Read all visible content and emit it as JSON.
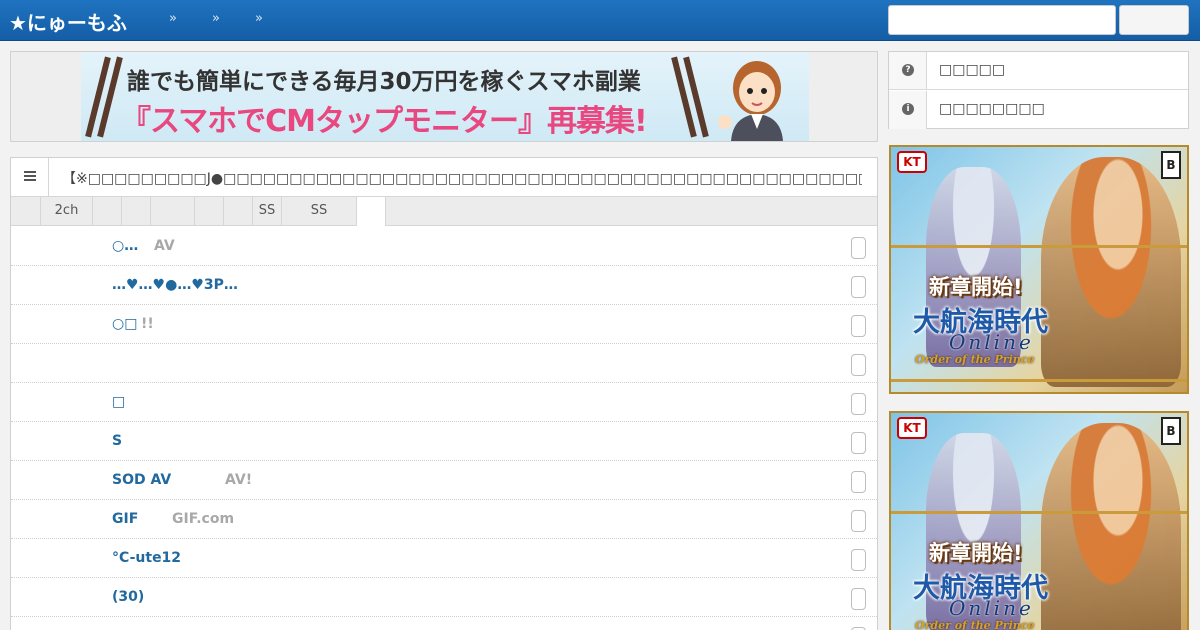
{
  "header": {
    "brand": "★にゅーもふ",
    "nav": [
      "»",
      "»",
      "»"
    ],
    "search": {
      "placeholder": "",
      "value": "",
      "button_label": ""
    }
  },
  "top_ad": {
    "line1": "誰でも簡単にできる毎月30万円を稼ぐスマホ副業",
    "line2": "『スマホでCMタップモニター』再募集!",
    "info_glyph": "i"
  },
  "sidebar": {
    "items": [
      {
        "label": "□□□□□",
        "icon": "question-circle-icon",
        "glyph": "?"
      },
      {
        "label": "□□□□□□□□",
        "icon": "info-circle-icon",
        "glyph": "i"
      }
    ],
    "ads": [
      {
        "logo": "KT",
        "rating": "B",
        "title1": "新章開始!",
        "title2": "大航海時代",
        "title3": "Online",
        "title4": "Order of the Prince"
      },
      {
        "logo": "KT",
        "rating": "B",
        "title1": "新章開始!",
        "title2": "大航海時代",
        "title3": "Online",
        "title4": "Order of the Prince"
      }
    ]
  },
  "main": {
    "headline_icon": "list-icon",
    "headline": "【※□□□□□□□□□J●□□□□□□□□□□□□□□□□□□□□□□□□□□□□□□□□□□□□□□□□□□□□□□□□□□□ □□",
    "tabs": [
      "",
      "2ch",
      "",
      "",
      "",
      "",
      "",
      "SS",
      ""
    ],
    "rows": [
      {
        "title": "○…",
        "source": "AV"
      },
      {
        "title": "…♥…♥●…♥3P…",
        "source": ""
      },
      {
        "title": "○□",
        "source": "!!"
      },
      {
        "title": "",
        "source": ""
      },
      {
        "title": "□",
        "source": ""
      },
      {
        "title": "S",
        "source": ""
      },
      {
        "title": "SOD AV",
        "source": "AV!"
      },
      {
        "title": "GIF",
        "source": "GIF.com"
      },
      {
        "title": "°C-ute12",
        "source": ""
      },
      {
        "title": "(30)",
        "source": ""
      },
      {
        "title": "",
        "source": ""
      }
    ]
  }
}
